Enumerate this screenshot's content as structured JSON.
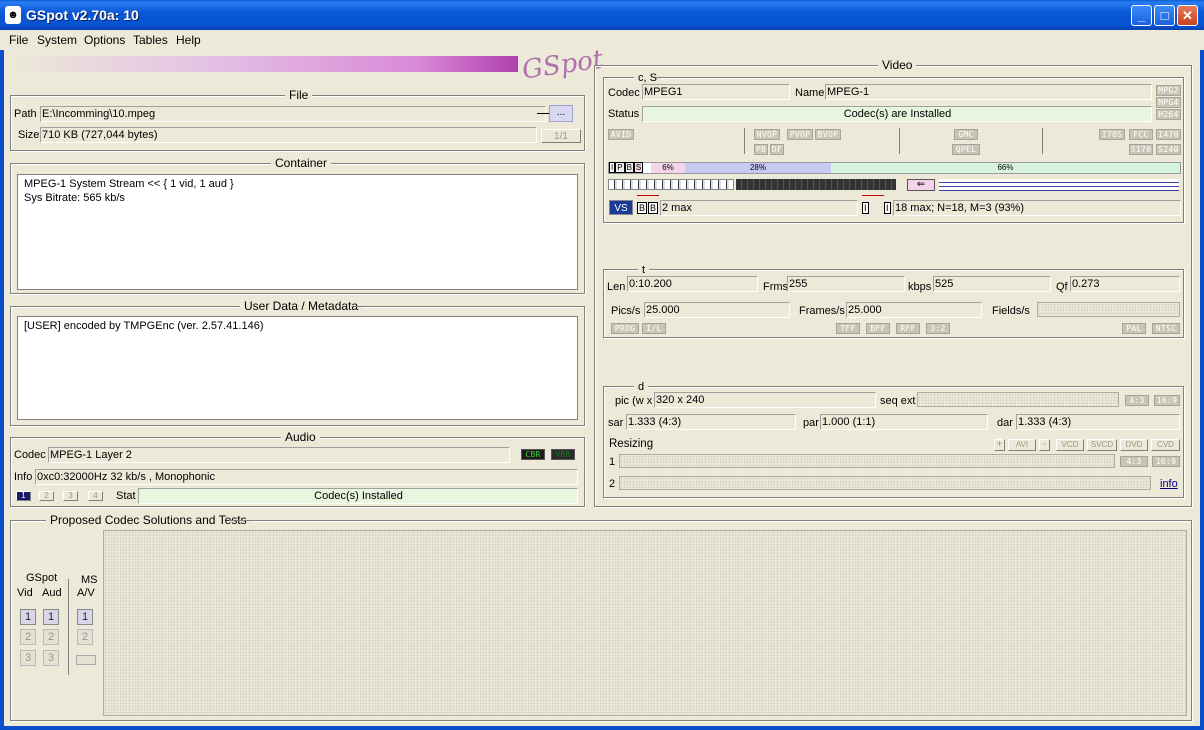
{
  "window": {
    "title": "GSpot v2.70a: 10"
  },
  "menu": [
    "File",
    "System",
    "Options",
    "Tables",
    "Help"
  ],
  "logo": "GSpot",
  "file": {
    "title": "File",
    "path_label": "Path",
    "path_value": "E:\\Incomming\\10.mpeg",
    "browse_label": "...",
    "size_label": "Size",
    "size_value": "710 KB (727,044 bytes)",
    "part_label": "1/1"
  },
  "container": {
    "title": "Container",
    "lines": [
      "MPEG-1 System Stream << { 1 vid, 1 aud }",
      "Sys Bitrate: 565 kb/s"
    ]
  },
  "userdata": {
    "title": "User Data / Metadata",
    "line": "[USER]    encoded by TMPGEnc (ver. 2.57.41.146)"
  },
  "audio": {
    "title": "Audio",
    "codec_label": "Codec",
    "codec_value": "MPEG-1 Layer 2",
    "cbr": "CBR",
    "vbr": "VBR",
    "info_label": "Info",
    "info_value": "0xc0:32000Hz  32 kb/s , Monophonic",
    "stream_buttons": [
      "1",
      "2",
      "3",
      "4"
    ],
    "stat_label": "Stat",
    "stat_value": "Codec(s) Installed"
  },
  "video": {
    "title": "Video",
    "cs_title": "c, S",
    "codec_label": "Codec",
    "codec_value": "MPEG1",
    "name_label": "Name",
    "name_value": "MPEG-1",
    "status_label": "Status",
    "status_value": "Codec(s) are Installed",
    "side_tags": [
      "MPG2",
      "MPG4",
      "H264"
    ],
    "flags_row1": [
      "AVID",
      "NVOP",
      "PVOP",
      "BVOP",
      "GMC",
      "I70S",
      "FCC",
      "I470"
    ],
    "flags_row2": [
      "PB",
      "DF",
      "QPEL",
      "S170",
      "S240"
    ],
    "frame_types": [
      "I",
      "P",
      "B",
      "S"
    ],
    "pct_i": "6%",
    "pct_p": "28%",
    "pct_b": "66%",
    "bmax": "2 max",
    "gop": "18 max; N=18, M=3 (93%)",
    "t_title": "t",
    "len_label": "Len",
    "len_value": "0:10.200",
    "frms_label": "Frms",
    "frms_value": "255",
    "kbps_label": "kbps",
    "kbps_value": "525",
    "qf_label": "Qf",
    "qf_value": "0.273",
    "pics_label": "Pics/s",
    "pics_value": "25.000",
    "frames_label": "Frames/s",
    "frames_value": "25.000",
    "fields_label": "Fields/s",
    "fields_value": "",
    "t_tags": [
      "PROG",
      "I/L",
      "TFF",
      "BFF",
      "RFF",
      "3:2",
      "PAL",
      "NTSC"
    ],
    "d_title": "d",
    "pic_label": "pic (w x",
    "pic_value": "320 x 240",
    "seqext_label": "seq ext",
    "ar_tags": [
      "4:3",
      "16:9"
    ],
    "sar_label": "sar",
    "sar_value": "1.333 (4:3)",
    "par_label": "par",
    "par_value": "1.000 (1:1)",
    "dar_label": "dar",
    "dar_value": "1.333 (4:3)",
    "resizing_label": "Resizing",
    "resize_buttons": [
      "+",
      "AVI",
      "-",
      "VCD",
      "SVCD",
      "DVD",
      "CVD"
    ],
    "row1_label": "1",
    "row2_label": "2",
    "ar2_tags": [
      "4:3",
      "16:9"
    ],
    "info_link": "info"
  },
  "proposed": {
    "title": "Proposed Codec Solutions and Tests",
    "gspot_label": "GSpot",
    "vid_label": "Vid",
    "aud_label": "Aud",
    "ms_label": "MS",
    "av_label": "A/V",
    "nums": [
      "1",
      "2",
      "3"
    ]
  },
  "colors": {
    "accent": "#0a58d6",
    "status_green": "#e8f6e0",
    "bar_i": "#f4d4e8",
    "bar_p": "#c8c8f4",
    "bar_b": "#d8f4e0"
  }
}
